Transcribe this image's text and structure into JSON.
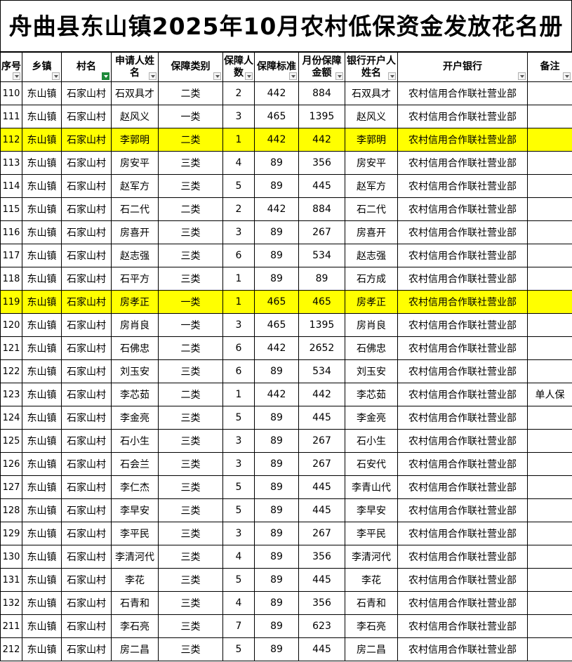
{
  "title": "舟曲县东山镇2025年10月农村低保资金发放花名册",
  "headers": [
    "序号",
    "乡镇",
    "村名",
    "申请人姓名",
    "保障类别",
    "保障人数",
    "保障标准",
    "月份保障金额",
    "银行开户人姓名",
    "开户银行",
    "备注"
  ],
  "rows": [
    {
      "seq": "110",
      "town": "东山镇",
      "village": "石家山村",
      "applicant": "石双具才",
      "category": "二类",
      "count": "2",
      "standard": "442",
      "amount": "884",
      "account": "石双具才",
      "bank": "农村信用合作联社营业部",
      "note": ""
    },
    {
      "seq": "111",
      "town": "东山镇",
      "village": "石家山村",
      "applicant": "赵风义",
      "category": "一类",
      "count": "3",
      "standard": "465",
      "amount": "1395",
      "account": "赵风义",
      "bank": "农村信用合作联社营业部",
      "note": ""
    },
    {
      "seq": "112",
      "town": "东山镇",
      "village": "石家山村",
      "applicant": "李郭明",
      "category": "二类",
      "count": "1",
      "standard": "442",
      "amount": "442",
      "account": "李郭明",
      "bank": "农村信用合作联社营业部",
      "note": "",
      "highlight": true
    },
    {
      "seq": "113",
      "town": "东山镇",
      "village": "石家山村",
      "applicant": "房安平",
      "category": "三类",
      "count": "4",
      "standard": "89",
      "amount": "356",
      "account": "房安平",
      "bank": "农村信用合作联社营业部",
      "note": ""
    },
    {
      "seq": "114",
      "town": "东山镇",
      "village": "石家山村",
      "applicant": "赵军方",
      "category": "三类",
      "count": "5",
      "standard": "89",
      "amount": "445",
      "account": "赵军方",
      "bank": "农村信用合作联社营业部",
      "note": ""
    },
    {
      "seq": "115",
      "town": "东山镇",
      "village": "石家山村",
      "applicant": "石二代",
      "category": "二类",
      "count": "2",
      "standard": "442",
      "amount": "884",
      "account": "石二代",
      "bank": "农村信用合作联社营业部",
      "note": ""
    },
    {
      "seq": "116",
      "town": "东山镇",
      "village": "石家山村",
      "applicant": "房喜开",
      "category": "三类",
      "count": "3",
      "standard": "89",
      "amount": "267",
      "account": "房喜开",
      "bank": "农村信用合作联社营业部",
      "note": ""
    },
    {
      "seq": "117",
      "town": "东山镇",
      "village": "石家山村",
      "applicant": "赵志强",
      "category": "三类",
      "count": "6",
      "standard": "89",
      "amount": "534",
      "account": "赵志强",
      "bank": "农村信用合作联社营业部",
      "note": ""
    },
    {
      "seq": "118",
      "town": "东山镇",
      "village": "石家山村",
      "applicant": "石平方",
      "category": "三类",
      "count": "1",
      "standard": "89",
      "amount": "89",
      "account": "石方成",
      "bank": "农村信用合作联社营业部",
      "note": ""
    },
    {
      "seq": "119",
      "town": "东山镇",
      "village": "石家山村",
      "applicant": "房孝正",
      "category": "一类",
      "count": "1",
      "standard": "465",
      "amount": "465",
      "account": "房孝正",
      "bank": "农村信用合作联社营业部",
      "note": "",
      "highlight": true
    },
    {
      "seq": "120",
      "town": "东山镇",
      "village": "石家山村",
      "applicant": "房肖良",
      "category": "一类",
      "count": "3",
      "standard": "465",
      "amount": "1395",
      "account": "房肖良",
      "bank": "农村信用合作联社营业部",
      "note": ""
    },
    {
      "seq": "121",
      "town": "东山镇",
      "village": "石家山村",
      "applicant": "石佛忠",
      "category": "二类",
      "count": "6",
      "standard": "442",
      "amount": "2652",
      "account": "石佛忠",
      "bank": "农村信用合作联社营业部",
      "note": ""
    },
    {
      "seq": "122",
      "town": "东山镇",
      "village": "石家山村",
      "applicant": "刘玉安",
      "category": "三类",
      "count": "6",
      "standard": "89",
      "amount": "534",
      "account": "刘玉安",
      "bank": "农村信用合作联社营业部",
      "note": ""
    },
    {
      "seq": "123",
      "town": "东山镇",
      "village": "石家山村",
      "applicant": "李芯茹",
      "category": "二类",
      "count": "1",
      "standard": "442",
      "amount": "442",
      "account": "李芯茹",
      "bank": "农村信用合作联社营业部",
      "note": "单人保"
    },
    {
      "seq": "124",
      "town": "东山镇",
      "village": "石家山村",
      "applicant": "李金亮",
      "category": "三类",
      "count": "5",
      "standard": "89",
      "amount": "445",
      "account": "李金亮",
      "bank": "农村信用合作联社营业部",
      "note": ""
    },
    {
      "seq": "125",
      "town": "东山镇",
      "village": "石家山村",
      "applicant": "石小生",
      "category": "三类",
      "count": "3",
      "standard": "89",
      "amount": "267",
      "account": "石小生",
      "bank": "农村信用合作联社营业部",
      "note": ""
    },
    {
      "seq": "126",
      "town": "东山镇",
      "village": "石家山村",
      "applicant": "石会兰",
      "category": "三类",
      "count": "3",
      "standard": "89",
      "amount": "267",
      "account": "石安代",
      "bank": "农村信用合作联社营业部",
      "note": ""
    },
    {
      "seq": "127",
      "town": "东山镇",
      "village": "石家山村",
      "applicant": "李仁杰",
      "category": "三类",
      "count": "5",
      "standard": "89",
      "amount": "445",
      "account": "李青山代",
      "bank": "农村信用合作联社营业部",
      "note": ""
    },
    {
      "seq": "128",
      "town": "东山镇",
      "village": "石家山村",
      "applicant": "李早安",
      "category": "三类",
      "count": "5",
      "standard": "89",
      "amount": "445",
      "account": "李早安",
      "bank": "农村信用合作联社营业部",
      "note": ""
    },
    {
      "seq": "129",
      "town": "东山镇",
      "village": "石家山村",
      "applicant": "李平民",
      "category": "三类",
      "count": "3",
      "standard": "89",
      "amount": "267",
      "account": "李平民",
      "bank": "农村信用合作联社营业部",
      "note": ""
    },
    {
      "seq": "130",
      "town": "东山镇",
      "village": "石家山村",
      "applicant": "李清河代",
      "category": "三类",
      "count": "4",
      "standard": "89",
      "amount": "356",
      "account": "李清河代",
      "bank": "农村信用合作联社营业部",
      "note": ""
    },
    {
      "seq": "131",
      "town": "东山镇",
      "village": "石家山村",
      "applicant": "李花",
      "category": "三类",
      "count": "5",
      "standard": "89",
      "amount": "445",
      "account": "李花",
      "bank": "农村信用合作联社营业部",
      "note": ""
    },
    {
      "seq": "132",
      "town": "东山镇",
      "village": "石家山村",
      "applicant": "石青和",
      "category": "三类",
      "count": "4",
      "standard": "89",
      "amount": "356",
      "account": "石青和",
      "bank": "农村信用合作联社营业部",
      "note": ""
    },
    {
      "seq": "211",
      "town": "东山镇",
      "village": "石家山村",
      "applicant": "李石亮",
      "category": "三类",
      "count": "7",
      "standard": "89",
      "amount": "623",
      "account": "李石亮",
      "bank": "农村信用合作联社营业部",
      "note": ""
    },
    {
      "seq": "212",
      "town": "东山镇",
      "village": "石家山村",
      "applicant": "房二昌",
      "category": "三类",
      "count": "5",
      "standard": "89",
      "amount": "445",
      "account": "房二昌",
      "bank": "农村信用合作联社营业部",
      "note": ""
    }
  ]
}
